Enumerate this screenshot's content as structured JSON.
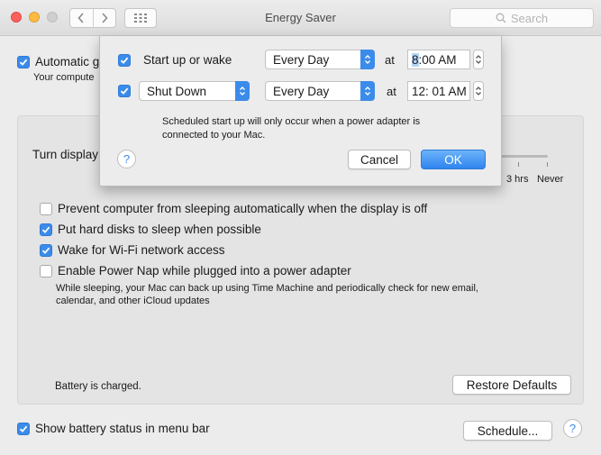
{
  "window": {
    "title": "Energy Saver",
    "search_placeholder": "Search"
  },
  "background": {
    "automatic_label": "Automatic g",
    "automatic_sub": "Your compute",
    "turn_display_label": "Turn display",
    "scale_labels": [
      "3 hrs",
      "Never"
    ],
    "options": [
      {
        "label": "Prevent computer from sleeping automatically when the display is off",
        "checked": false
      },
      {
        "label": "Put hard disks to sleep when possible",
        "checked": true
      },
      {
        "label": "Wake for Wi-Fi network access",
        "checked": true
      },
      {
        "label": "Enable Power Nap while plugged into a power adapter",
        "checked": false
      }
    ],
    "power_nap_sub_line1": "While sleeping, your Mac can back up using Time Machine and periodically check for new email,",
    "power_nap_sub_line2": "calendar, and other iCloud updates",
    "battery_status": "Battery is charged.",
    "restore_defaults": "Restore Defaults",
    "show_battery_label": "Show battery status in menu bar",
    "schedule_button": "Schedule..."
  },
  "sheet": {
    "row1": {
      "label": "Start up or wake",
      "checked": true,
      "frequency": "Every Day",
      "at": "at",
      "time_hour": "8",
      "time_rest": ":00 AM"
    },
    "row2": {
      "action": "Shut Down",
      "checked": true,
      "frequency": "Every Day",
      "at": "at",
      "time": "12: 01 AM"
    },
    "note_line1": "Scheduled start up will only occur when a power adapter is",
    "note_line2": "connected to your Mac.",
    "cancel": "Cancel",
    "ok": "OK",
    "help": "?"
  },
  "colors": {
    "accent": "#3b8bea",
    "close": "#fc605c",
    "minimize": "#fdbc40"
  }
}
